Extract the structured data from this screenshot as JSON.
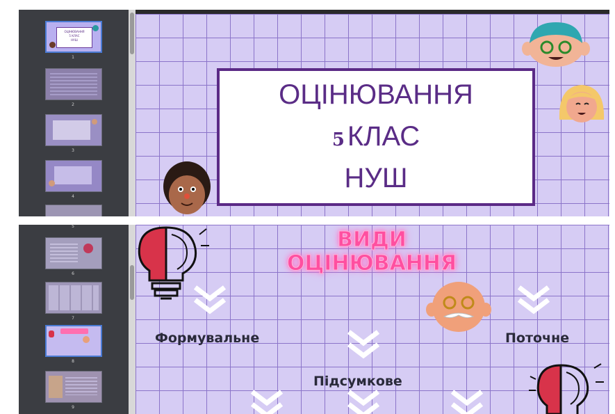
{
  "pane1": {
    "slide_title": {
      "line1": "ОЦІНЮВАННЯ",
      "line2_num": "5",
      "line2_text": "КЛАС",
      "line3": "НУШ"
    },
    "thumbnails": [
      {
        "num": "1",
        "label_lines": [
          "ОЦІНЮВАННЯ",
          "5 КЛАС",
          "НУШ"
        ],
        "selected": true
      },
      {
        "num": "2",
        "selected": false
      },
      {
        "num": "3",
        "selected": false
      },
      {
        "num": "4",
        "selected": false
      },
      {
        "num": "5",
        "selected": false
      }
    ]
  },
  "pane2": {
    "slide_title": {
      "line1": "ВИДИ",
      "line2": "ОЦІНЮВАННЯ"
    },
    "labels": {
      "formative": "Формувальне",
      "current": "Поточне",
      "summative": "Підсумкове"
    },
    "thumbnails": [
      {
        "num": "5",
        "selected": false
      },
      {
        "num": "6",
        "selected": false
      },
      {
        "num": "7",
        "selected": false
      },
      {
        "num": "8",
        "selected": true
      },
      {
        "num": "9",
        "selected": false
      }
    ]
  },
  "colors": {
    "sidebar_bg": "#3b3d42",
    "slide_bg": "#d6ccf4",
    "grid": "#8b74c9",
    "title_text": "#5a2c86",
    "title_border": "#5b2a86",
    "neon": "#ff4fa0",
    "selection": "#4a7bd4"
  },
  "icons": [
    "face-icon",
    "brain-bulb-icon",
    "chevron-double-down-icon"
  ]
}
